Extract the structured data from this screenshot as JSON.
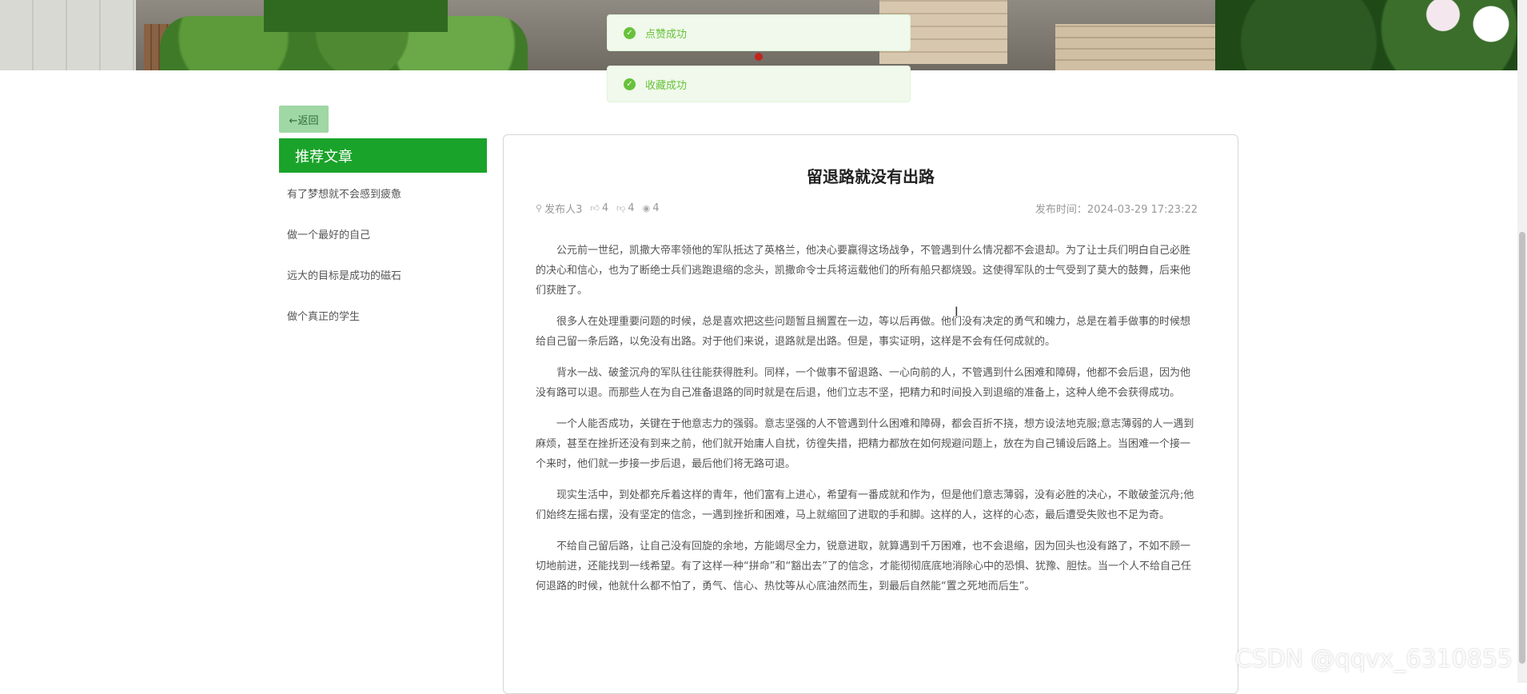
{
  "toasts": {
    "like": "点赞成功",
    "favorite": "收藏成功"
  },
  "back_button": "←返回",
  "sidebar": {
    "title": "推荐文章",
    "items": [
      "有了梦想就不会感到疲惫",
      "做一个最好的自己",
      "远大的目标是成功的磁石",
      "做个真正的学生"
    ]
  },
  "article": {
    "title": "留退路就没有出路",
    "author": "发布人3",
    "likes": "4",
    "dislikes": "4",
    "views": "4",
    "publish_time": "发布时间：2024-03-29 17:23:22",
    "paragraphs": [
      "公元前一世纪，凯撒大帝率领他的军队抵达了英格兰，他决心要赢得这场战争，不管遇到什么情况都不会退却。为了让士兵们明白自己必胜的决心和信心，也为了断绝士兵们逃跑退缩的念头，凯撒命令士兵将运载他们的所有船只都烧毁。这使得军队的士气受到了莫大的鼓舞，后来他们获胜了。",
      "很多人在处理重要问题的时候，总是喜欢把这些问题暂且搁置在一边，等以后再做。他们没有决定的勇气和魄力，总是在着手做事的时候想给自己留一条后路，以免没有出路。对于他们来说，退路就是出路。但是，事实证明，这样是不会有任何成就的。",
      "背水一战、破釜沉舟的军队往往能获得胜利。同样，一个做事不留退路、一心向前的人，不管遇到什么困难和障碍，他都不会后退，因为他没有路可以退。而那些人在为自己准备退路的同时就是在后退，他们立志不坚，把精力和时间投入到退缩的准备上，这种人绝不会获得成功。",
      "一个人能否成功，关键在于他意志力的强弱。意志坚强的人不管遇到什么困难和障碍，都会百折不挠，想方设法地克服;意志薄弱的人一遇到麻烦，甚至在挫折还没有到来之前，他们就开始庸人自扰，彷徨失措，把精力都放在如何规避问题上，放在为自己铺设后路上。当困难一个接一个来时，他们就一步接一步后退，最后他们将无路可退。",
      "现实生活中，到处都充斥着这样的青年，他们富有上进心，希望有一番成就和作为，但是他们意志薄弱，没有必胜的决心，不敢破釜沉舟;他们始终左摇右摆，没有坚定的信念，一遇到挫折和困难，马上就缩回了进取的手和脚。这样的人，这样的心态，最后遭受失败也不足为奇。",
      "不给自己留后路，让自己没有回旋的余地，方能竭尽全力，锐意进取，就算遇到千万困难，也不会退缩，因为回头也没有路了，不如不顾一切地前进，还能找到一线希望。有了这样一种“拼命”和“豁出去”了的信念，才能彻彻底底地消除心中的恐惧、犹豫、胆怯。当一个人不给自己任何退路的时候，他就什么都不怕了，勇气、信心、热忱等从心底油然而生，到最后自然能“置之死地而后生”。"
    ]
  },
  "watermark": "CSDN @qqvx_6310855",
  "colors": {
    "accent": "#1aa32a",
    "success": "#67c23a"
  }
}
